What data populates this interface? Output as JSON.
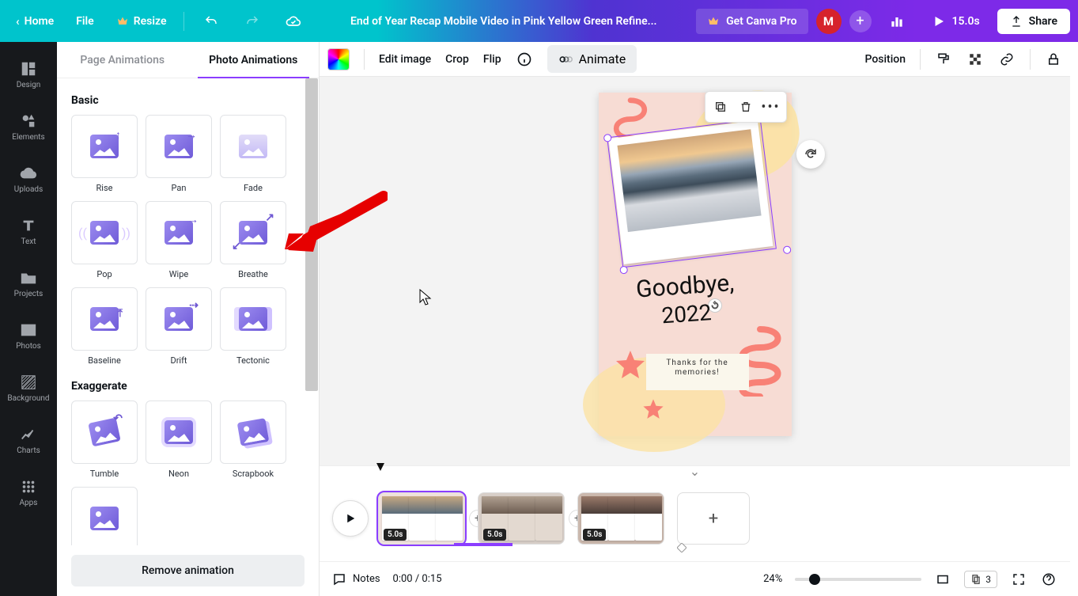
{
  "topbar": {
    "home": "Home",
    "file": "File",
    "resize": "Resize",
    "title": "End of Year Recap Mobile Video in Pink Yellow Green Refine...",
    "get_pro": "Get Canva Pro",
    "avatar_initial": "M",
    "duration": "15.0s",
    "share": "Share"
  },
  "rail": {
    "design": "Design",
    "elements": "Elements",
    "uploads": "Uploads",
    "text": "Text",
    "projects": "Projects",
    "photos": "Photos",
    "background": "Background",
    "charts": "Charts",
    "apps": "Apps"
  },
  "tabs": {
    "page": "Page Animations",
    "photo": "Photo Animations"
  },
  "sections": {
    "basic": "Basic",
    "exaggerate": "Exaggerate"
  },
  "anims": {
    "rise": "Rise",
    "pan": "Pan",
    "fade": "Fade",
    "pop": "Pop",
    "wipe": "Wipe",
    "breathe": "Breathe",
    "baseline": "Baseline",
    "drift": "Drift",
    "tectonic": "Tectonic",
    "tumble": "Tumble",
    "neon": "Neon",
    "scrapbook": "Scrapbook"
  },
  "remove": "Remove animation",
  "sec_tb": {
    "edit_image": "Edit image",
    "crop": "Crop",
    "flip": "Flip",
    "animate": "Animate",
    "position": "Position"
  },
  "page_content": {
    "script1": "Goodbye,",
    "script2": "2022",
    "note_l1": "Thanks for the",
    "note_l2": "memories!"
  },
  "timeline": {
    "clip1_dur": "5.0s",
    "clip2_dur": "5.0s",
    "clip3_dur": "5.0s"
  },
  "status": {
    "notes": "Notes",
    "time": "0:00 / 0:15",
    "zoom": "24%",
    "page_count": "3"
  }
}
